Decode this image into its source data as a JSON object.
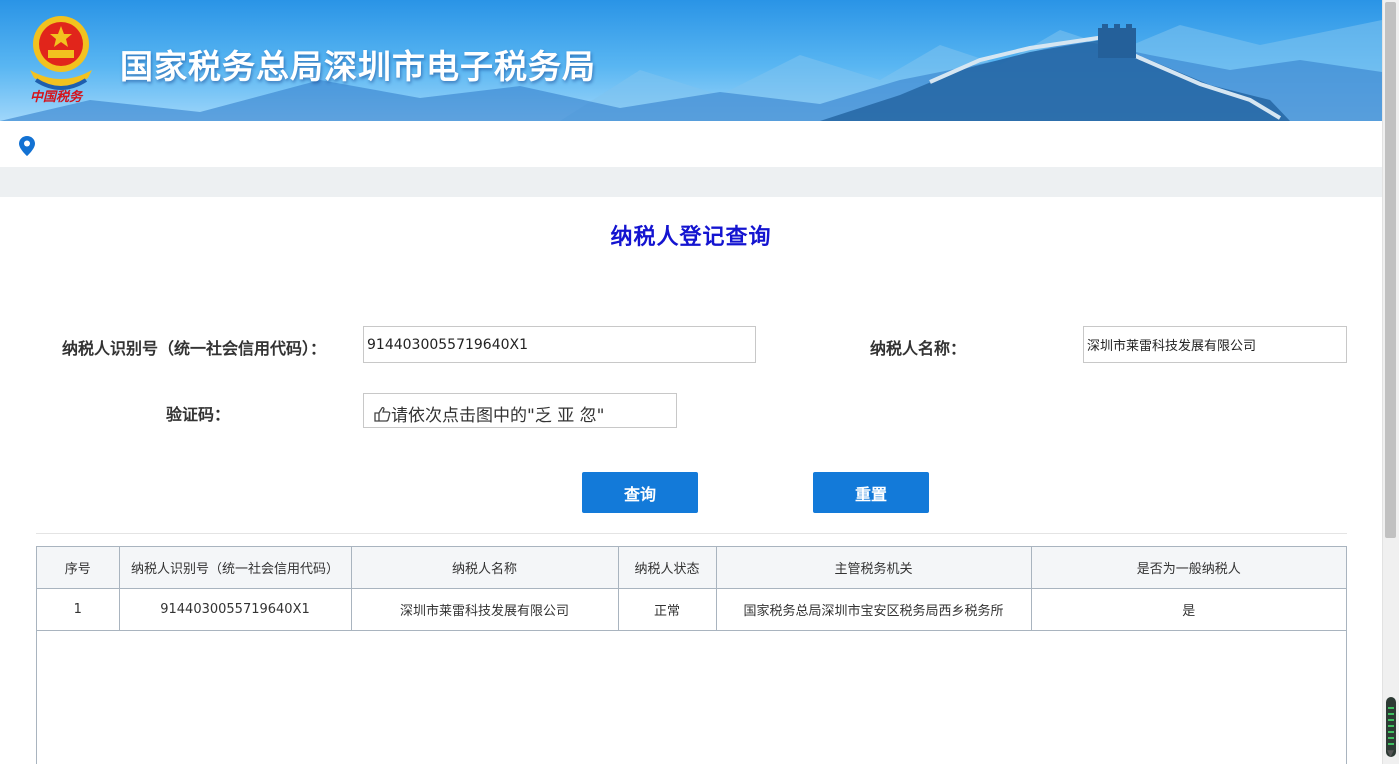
{
  "header": {
    "title": "国家税务总局深圳市电子税务局",
    "emblem_text": "中国税务"
  },
  "page": {
    "title": "纳税人登记查询"
  },
  "form": {
    "taxpayer_id_label": "纳税人识别号（统一社会信用代码）：",
    "taxpayer_id_value": "9144030055719640X1",
    "taxpayer_name_label": "纳税人名称：",
    "taxpayer_name_value": "深圳市莱雷科技发展有限公司",
    "captcha_label": "验证码：",
    "captcha_prompt": "请依次点击图中的\"乏 亚 忽\"",
    "captcha_icon": "pointing-hand-icon"
  },
  "buttons": {
    "query": "查询",
    "reset": "重置"
  },
  "table": {
    "headers": [
      "序号",
      "纳税人识别号（统一社会信用代码）",
      "纳税人名称",
      "纳税人状态",
      "主管税务机关",
      "是否为一般纳税人"
    ],
    "rows": [
      [
        "1",
        "9144030055719640X1",
        "深圳市莱雷科技发展有限公司",
        "正常",
        "国家税务总局深圳市宝安区税务局西乡税务所",
        "是"
      ]
    ]
  },
  "colors": {
    "banner": "#2a94e6",
    "title": "#1414d0",
    "button": "#137ad9"
  }
}
